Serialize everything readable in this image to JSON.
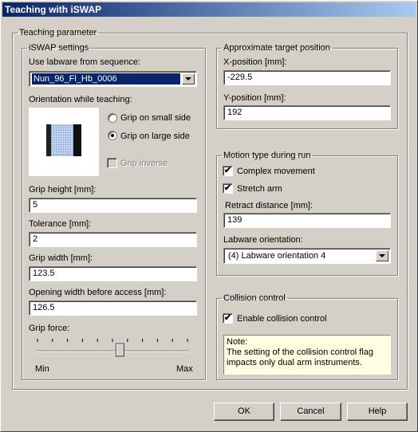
{
  "window": {
    "title": "Teaching with iSWAP"
  },
  "groups": {
    "teaching_parameter": "Teaching parameter",
    "iswap_settings": "iSWAP settings",
    "target_position": "Approximate target position",
    "motion_type": "Motion type during run",
    "collision": "Collision control"
  },
  "iswap": {
    "labware_label": "Use labware from sequence:",
    "labware_value": "Nun_96_Fl_Hb_0006",
    "orientation_label": "Orientation while teaching:",
    "grip_small": "Grip on small side",
    "grip_large": "Grip on large side",
    "grip_inverse": "Grip inverse",
    "grip_height_label": "Grip height [mm]:",
    "grip_height": "5",
    "tolerance_label": "Tolerance [mm]:",
    "tolerance": "2",
    "grip_width_label": "Grip width [mm]:",
    "grip_width": "123.5",
    "opening_width_label": "Opening width before access [mm]:",
    "opening_width": "126.5",
    "grip_force_label": "Grip force:",
    "grip_force_min": "Min",
    "grip_force_max": "Max",
    "grip_force_level": 0.55
  },
  "target": {
    "x_label": "X-position [mm]:",
    "x_value": "-229.5",
    "y_label": "Y-position [mm]:",
    "y_value": "192"
  },
  "motion": {
    "complex_label": "Complex movement",
    "complex_checked": true,
    "stretch_label": "Stretch arm",
    "stretch_checked": true,
    "retract_label": "Retract distance [mm]:",
    "retract_value": "139",
    "orientation_label": "Labware orientation:",
    "orientation_value": "(4) Labware orientation 4"
  },
  "collision": {
    "enable_label": "Enable collision control",
    "enable_checked": true,
    "note": "Note:\nThe setting of the collision control flag impacts only dual arm instruments."
  },
  "buttons": {
    "ok": "OK",
    "cancel": "Cancel",
    "help": "Help"
  }
}
